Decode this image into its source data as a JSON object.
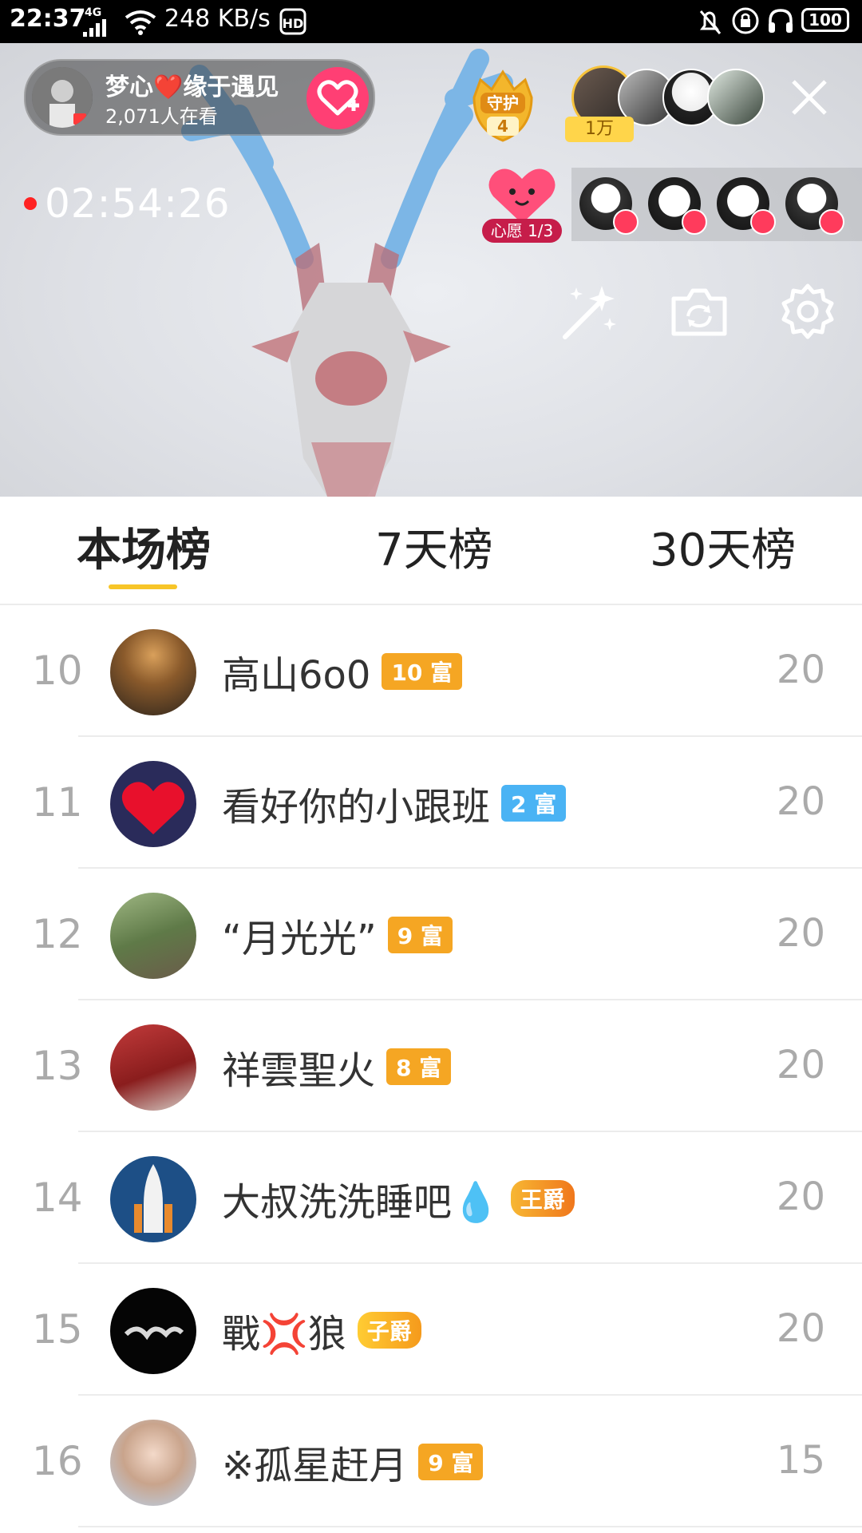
{
  "status_bar": {
    "time": "22:37",
    "network": "4G",
    "speed": "248 KB/s",
    "battery": "100"
  },
  "live": {
    "host_name": "梦心❤️缘于遇见",
    "viewers": "2,071人在看",
    "guard_label": "守护",
    "guard_count": "4",
    "top_fan_tag": "1万",
    "timer": "02:54:26",
    "wish_label": "心愿 1/3"
  },
  "tabs": [
    {
      "label": "本场榜",
      "active": true
    },
    {
      "label": "7天榜",
      "active": false
    },
    {
      "label": "30天榜",
      "active": false
    }
  ],
  "rows": [
    {
      "rank": "10",
      "name": "高山6o0",
      "badge": "10 富",
      "badge_color": "#f5a623",
      "score": "20"
    },
    {
      "rank": "11",
      "name": "看好你的小跟班",
      "badge": "2 富",
      "badge_color": "#4ab3f4",
      "score": "20"
    },
    {
      "rank": "12",
      "name": "“月光光”",
      "badge": "9 富",
      "badge_color": "#f5a623",
      "score": "20"
    },
    {
      "rank": "13",
      "name": "祥雲聖火",
      "badge": "8 富",
      "badge_color": "#f5a623",
      "score": "20"
    },
    {
      "rank": "14",
      "name": "大叔洗洗睡吧💧",
      "badge": "王爵",
      "badge_color": "#f08a1c",
      "score": "20"
    },
    {
      "rank": "15",
      "name": "戰💢狼",
      "badge": "子爵",
      "badge_color": "#f5a623",
      "score": "20"
    },
    {
      "rank": "16",
      "name": "※孤星赶月",
      "badge": "9 富",
      "badge_color": "#f5a623",
      "score": "15"
    }
  ]
}
